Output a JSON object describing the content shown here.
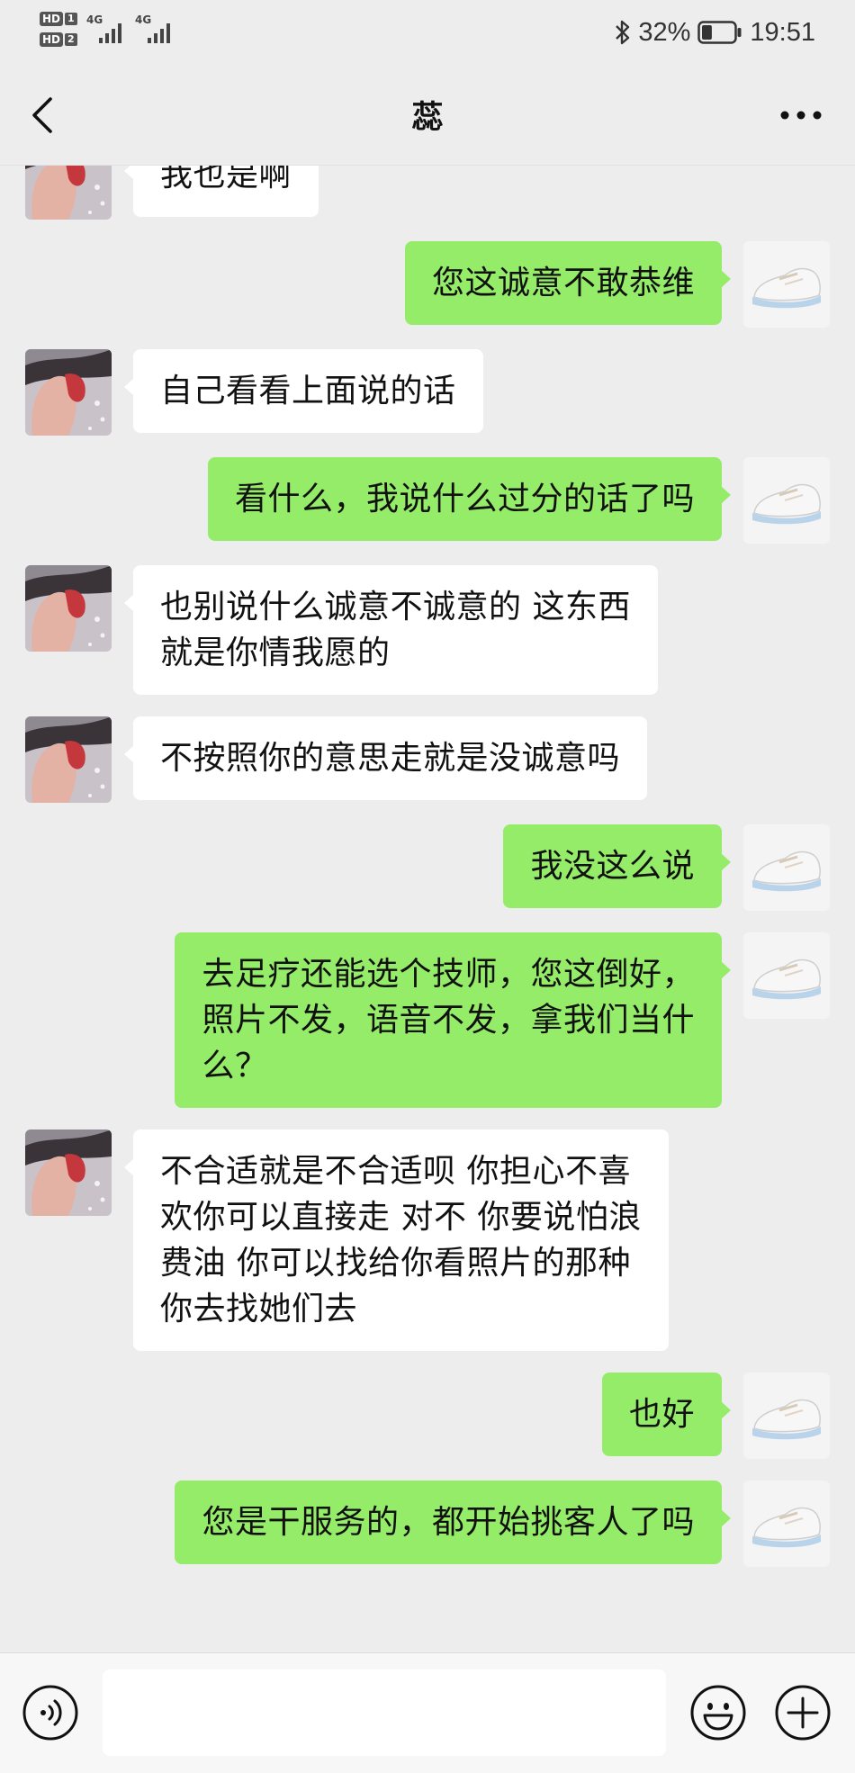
{
  "status_bar": {
    "sim1_badge": "HD",
    "sim1_num": "1",
    "sim2_badge": "HD",
    "sim2_num": "2",
    "signal1_label": "4G",
    "signal2_label": "4G",
    "battery_percent": "32%",
    "time": "19:51",
    "battery_level": 0.32,
    "icons": [
      "bluetooth-icon",
      "battery-icon"
    ]
  },
  "header": {
    "title": "蕊",
    "back_icon": "chevron-left-icon",
    "more_icon": "more-dots-icon"
  },
  "messages": [
    {
      "side": "left",
      "text": "我也是啊"
    },
    {
      "side": "right",
      "text": "您这诚意不敢恭维"
    },
    {
      "side": "left",
      "text": "自己看看上面说的话"
    },
    {
      "side": "right",
      "text": "看什么，我说什么过分的话了吗"
    },
    {
      "side": "left",
      "text": "也别说什么诚意不诚意的 这东西\n就是你情我愿的"
    },
    {
      "side": "left",
      "text": "不按照你的意思走就是没诚意吗"
    },
    {
      "side": "right",
      "text": "我没这么说"
    },
    {
      "side": "right",
      "text": "去足疗还能选个技师，您这倒好，\n照片不发，语音不发，拿我们当什\n么？"
    },
    {
      "side": "left",
      "text": "不合适就是不合适呗 你担心不喜\n欢你可以直接走 对不 你要说怕浪\n费油 你可以找给你看照片的那种\n你去找她们去"
    },
    {
      "side": "right",
      "text": "也好"
    },
    {
      "side": "right",
      "text": "您是干服务的，都开始挑客人了吗"
    }
  ],
  "input_bar": {
    "voice_icon": "voice-icon",
    "emoji_icon": "emoji-icon",
    "plus_icon": "plus-icon",
    "input_value": ""
  },
  "colors": {
    "background": "#ededed",
    "self_bubble": "#95ec69",
    "other_bubble": "#ffffff"
  }
}
